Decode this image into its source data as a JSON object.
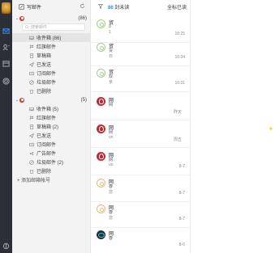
{
  "toolbar": {
    "compose_label": "写邮件"
  },
  "accounts": [
    {
      "name": "              ",
      "count": "(86)",
      "search_placeholder": "搜索邮件",
      "folders": [
        {
          "label": "收件箱 (86)",
          "icon": "inbox-icon",
          "selected": true
        },
        {
          "label": "红旗邮件",
          "icon": "flag-icon"
        },
        {
          "label": "草稿箱",
          "icon": "draft-icon"
        },
        {
          "label": "已发送",
          "icon": "sent-icon"
        },
        {
          "label": "订阅邮件",
          "icon": "subscribe-icon"
        },
        {
          "label": "垃圾邮件",
          "icon": "spam-icon"
        },
        {
          "label": "已删除",
          "icon": "trash-icon"
        }
      ]
    },
    {
      "name": "                ",
      "count": "(5)",
      "folders": [
        {
          "label": "收件箱 (5)",
          "icon": "inbox-icon"
        },
        {
          "label": "红旗邮件",
          "icon": "flag-icon"
        },
        {
          "label": "草稿箱 (2)",
          "icon": "draft-icon"
        },
        {
          "label": "已发送",
          "icon": "sent-icon"
        },
        {
          "label": "订阅邮件",
          "icon": "subscribe-icon"
        },
        {
          "label": "广告邮件",
          "icon": "ad-icon"
        },
        {
          "label": "垃圾邮件 (2)",
          "icon": "spam-icon"
        },
        {
          "label": "已删除",
          "icon": "trash-icon"
        }
      ]
    }
  ],
  "add_account_label": "+ 添加邮箱帐号",
  "list_header": {
    "unread_count": "86",
    "unread_label": "封未读",
    "mark_all_label": "全标已读"
  },
  "messages": [
    {
      "sender": "贸",
      "line2": "3",
      "line3": "1",
      "time": "10:25",
      "avatar": "outline"
    },
    {
      "sender": "贸",
      "line2": "贷",
      "line3": "日",
      "time": "10:34",
      "avatar": "outline"
    },
    {
      "sender": "贸",
      "line2": "双",
      "line3": "亲",
      "time": "10:31",
      "avatar": "outline"
    },
    {
      "sender": "网",
      "line2": "网",
      "line3": "",
      "time": "昨天",
      "avatar": "red"
    },
    {
      "sender": "网",
      "line2": "网",
      "line3": "un",
      "time": "周五",
      "avatar": "red"
    },
    {
      "sender": "网",
      "line2": "网",
      "line3": "un",
      "time": "8-7",
      "avatar": "red"
    },
    {
      "sender": "网",
      "line2": "春",
      "line3": "您",
      "time": "8-7",
      "avatar": "outline-orange"
    },
    {
      "sender": "网",
      "line2": "春",
      "line3": "您",
      "time": "8-7",
      "avatar": "outline-orange"
    },
    {
      "sender": "网",
      "line2": "春",
      "line3": "",
      "time": "8-6",
      "avatar": "dark"
    }
  ],
  "colors": {
    "accent": "#2f8bff",
    "rail": "#2b2f36",
    "netease_red": "#c0282d"
  }
}
